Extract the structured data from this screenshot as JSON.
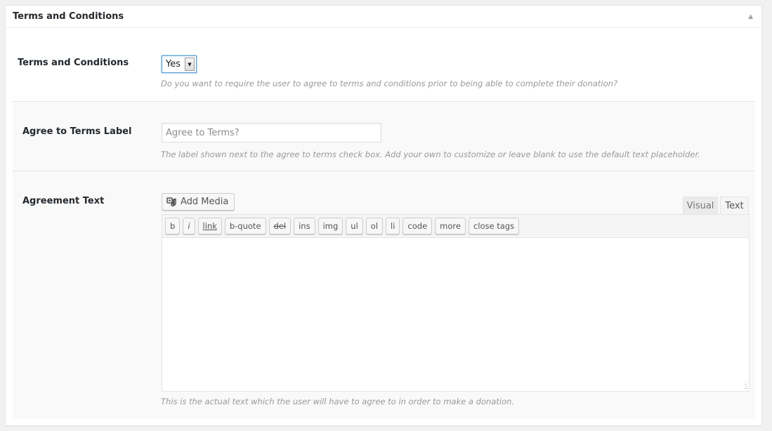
{
  "metabox": {
    "title": "Terms and Conditions",
    "toggle_icon": "triangle-up"
  },
  "terms_toggle": {
    "label": "Terms and Conditions",
    "selected": "Yes",
    "description": "Do you want to require the user to agree to terms and conditions prior to being able to complete their donation?"
  },
  "agree_label": {
    "label": "Agree to Terms Label",
    "placeholder": "Agree to Terms?",
    "value": "",
    "description": "The label shown next to the agree to terms check box. Add your own to customize or leave blank to use the default text placeholder."
  },
  "agreement_text": {
    "label": "Agreement Text",
    "add_media_label": "Add Media",
    "tabs": {
      "visual": "Visual",
      "text": "Text"
    },
    "quicktags": [
      "b",
      "i",
      "link",
      "b-quote",
      "del",
      "ins",
      "img",
      "ul",
      "ol",
      "li",
      "code",
      "more",
      "close tags"
    ],
    "content": "",
    "description": "This is the actual text which the user will have to agree to in order to make a donation."
  }
}
